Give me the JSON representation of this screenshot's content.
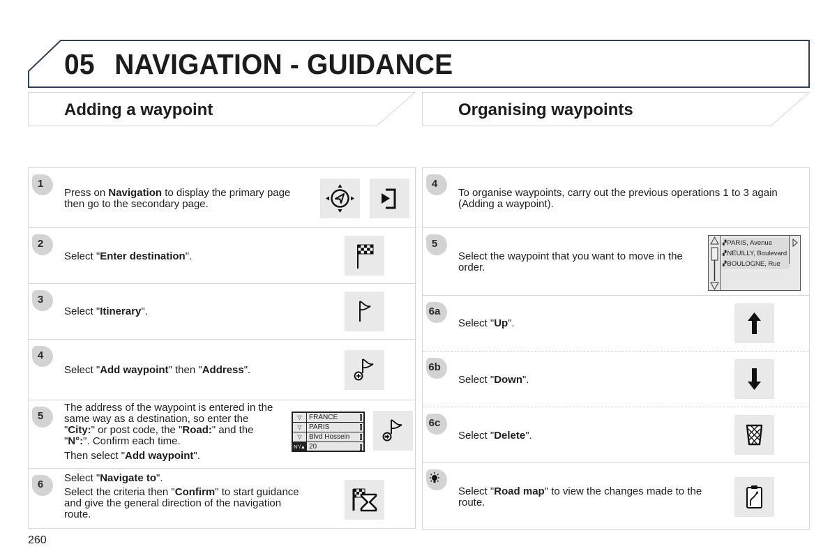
{
  "chapter": {
    "number": "05",
    "title": "NAVIGATION - GUIDANCE"
  },
  "colors": {
    "header_border": "#2e4057",
    "panel_border": "#d6d6d6",
    "badge_bg": "#d3d3d3",
    "icon_bg": "#e9e9e9"
  },
  "left_section": {
    "title": "Adding a waypoint",
    "steps": [
      {
        "badge": "1",
        "parts": [
          [
            "Press on ",
            false
          ],
          [
            "Navigation",
            true
          ],
          [
            " to display the primary page then go to the secondary page.",
            false
          ]
        ],
        "icons": [
          "navigation-joystick-icon",
          "secondary-page-icon"
        ]
      },
      {
        "badge": "2",
        "parts": [
          [
            "Select \"",
            false
          ],
          [
            "Enter destination",
            true
          ],
          [
            "\".",
            false
          ]
        ],
        "icons": [
          "checkered-flag-icon"
        ]
      },
      {
        "badge": "3",
        "parts": [
          [
            "Select \"",
            false
          ],
          [
            "Itinerary",
            true
          ],
          [
            "\".",
            false
          ]
        ],
        "icons": [
          "itinerary-flag-icon"
        ]
      },
      {
        "badge": "4",
        "parts": [
          [
            "Select \"",
            false
          ],
          [
            "Add waypoint",
            true
          ],
          [
            "\" then \"",
            false
          ],
          [
            "Address",
            true
          ],
          [
            "\".",
            false
          ]
        ],
        "icons": [
          "add-waypoint-icon"
        ]
      },
      {
        "badge": "5",
        "parts": [
          [
            "The address of the waypoint is entered in the same way as a destination, so enter the \"",
            false
          ],
          [
            "City:",
            true
          ],
          [
            "\" or post code, the \"",
            false
          ],
          [
            "Road:",
            true
          ],
          [
            "\" and the \"",
            false
          ],
          [
            "N°:",
            true
          ],
          [
            "\". Confirm each time.",
            false
          ]
        ],
        "parts2": [
          [
            "Then select \"",
            false
          ],
          [
            "Add waypoint",
            true
          ],
          [
            "\".",
            false
          ]
        ],
        "icons": [
          "confirm-waypoint-icon"
        ],
        "address_form": {
          "rows": [
            {
              "lead": "▽",
              "value": "FRANCE"
            },
            {
              "lead": "▽",
              "value": "PARIS"
            },
            {
              "lead": "▽",
              "value": "Blvd Hossein"
            },
            {
              "lead": "N°/▲",
              "value": "20"
            }
          ]
        }
      },
      {
        "badge": "6",
        "parts": [
          [
            "Select \"",
            false
          ],
          [
            "Navigate to",
            true
          ],
          [
            "\".",
            false
          ]
        ],
        "parts2": [
          [
            "Select the criteria then \"",
            false
          ],
          [
            "Confirm",
            true
          ],
          [
            "\" to start guidance and give the general direction of the navigation route.",
            false
          ]
        ],
        "icons": [
          "navigate-to-icon"
        ]
      }
    ]
  },
  "right_section": {
    "title": "Organising waypoints",
    "steps": [
      {
        "badge": "4",
        "parts": [
          [
            "To organise waypoints, carry out the previous operations 1 to 3 again (Adding a waypoint).",
            false
          ]
        ]
      },
      {
        "badge": "5",
        "parts": [
          [
            "Select the waypoint that you want to move in the order.",
            false
          ]
        ],
        "waypoint_list": {
          "items": [
            "PARIS, Avenue",
            "NEUILLY, Boulevard",
            "BOULOGNE, Rue"
          ]
        }
      },
      {
        "badge": "6a",
        "parts": [
          [
            "Select \"",
            false
          ],
          [
            "Up",
            true
          ],
          [
            "\".",
            false
          ]
        ],
        "icons": [
          "arrow-up-icon"
        ]
      },
      {
        "badge": "6b",
        "parts": [
          [
            "Select \"",
            false
          ],
          [
            "Down",
            true
          ],
          [
            "\".",
            false
          ]
        ],
        "icons": [
          "arrow-down-icon"
        ]
      },
      {
        "badge": "6c",
        "parts": [
          [
            "Select \"",
            false
          ],
          [
            "Delete",
            true
          ],
          [
            "\".",
            false
          ]
        ],
        "icons": [
          "delete-bin-icon"
        ]
      },
      {
        "badge": "tip-icon",
        "parts": [
          [
            "Select \"",
            false
          ],
          [
            "Road map",
            true
          ],
          [
            "\" to view the changes made to the route.",
            false
          ]
        ],
        "icons": [
          "road-map-icon"
        ]
      }
    ]
  },
  "page_number": "260"
}
